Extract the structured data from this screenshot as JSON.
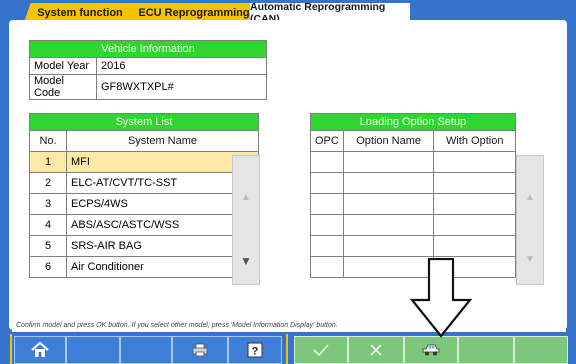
{
  "tabs": [
    {
      "label": "System function"
    },
    {
      "label": "ECU Reprogramming"
    },
    {
      "label": "Automatic Reprogramming (CAN)"
    }
  ],
  "vehicle_info": {
    "title": "Vehicle Information",
    "rows": [
      {
        "label": "Model Year",
        "value": "2016"
      },
      {
        "label": "Model Code",
        "value": "GF8WXTXPL#"
      }
    ]
  },
  "system_list": {
    "title": "System List",
    "col_no": "No.",
    "col_name": "System Name",
    "rows": [
      {
        "no": "1",
        "name": "MFI"
      },
      {
        "no": "2",
        "name": "ELC-AT/CVT/TC-SST"
      },
      {
        "no": "3",
        "name": "ECPS/4WS"
      },
      {
        "no": "4",
        "name": "ABS/ASC/ASTC/WSS"
      },
      {
        "no": "5",
        "name": "SRS-AIR BAG"
      },
      {
        "no": "6",
        "name": "Air Conditioner"
      }
    ]
  },
  "loading_option": {
    "title": "Loading Option Setup",
    "col_opc": "OPC",
    "col_name": "Option Name",
    "col_with": "With Option"
  },
  "status_text": "Confirm model and press OK button. If you select other model, press 'Model Information Display' button.",
  "colors": {
    "frame": "#3673cc",
    "header_green": "#2fd62f",
    "tab_yellow": "#f4c400",
    "selected_row": "#fce9a6"
  },
  "icons": [
    "home-icon",
    "print-icon",
    "help-icon",
    "ok-check-icon",
    "cancel-x-icon",
    "car-icon",
    "down-arrow-icon"
  ]
}
